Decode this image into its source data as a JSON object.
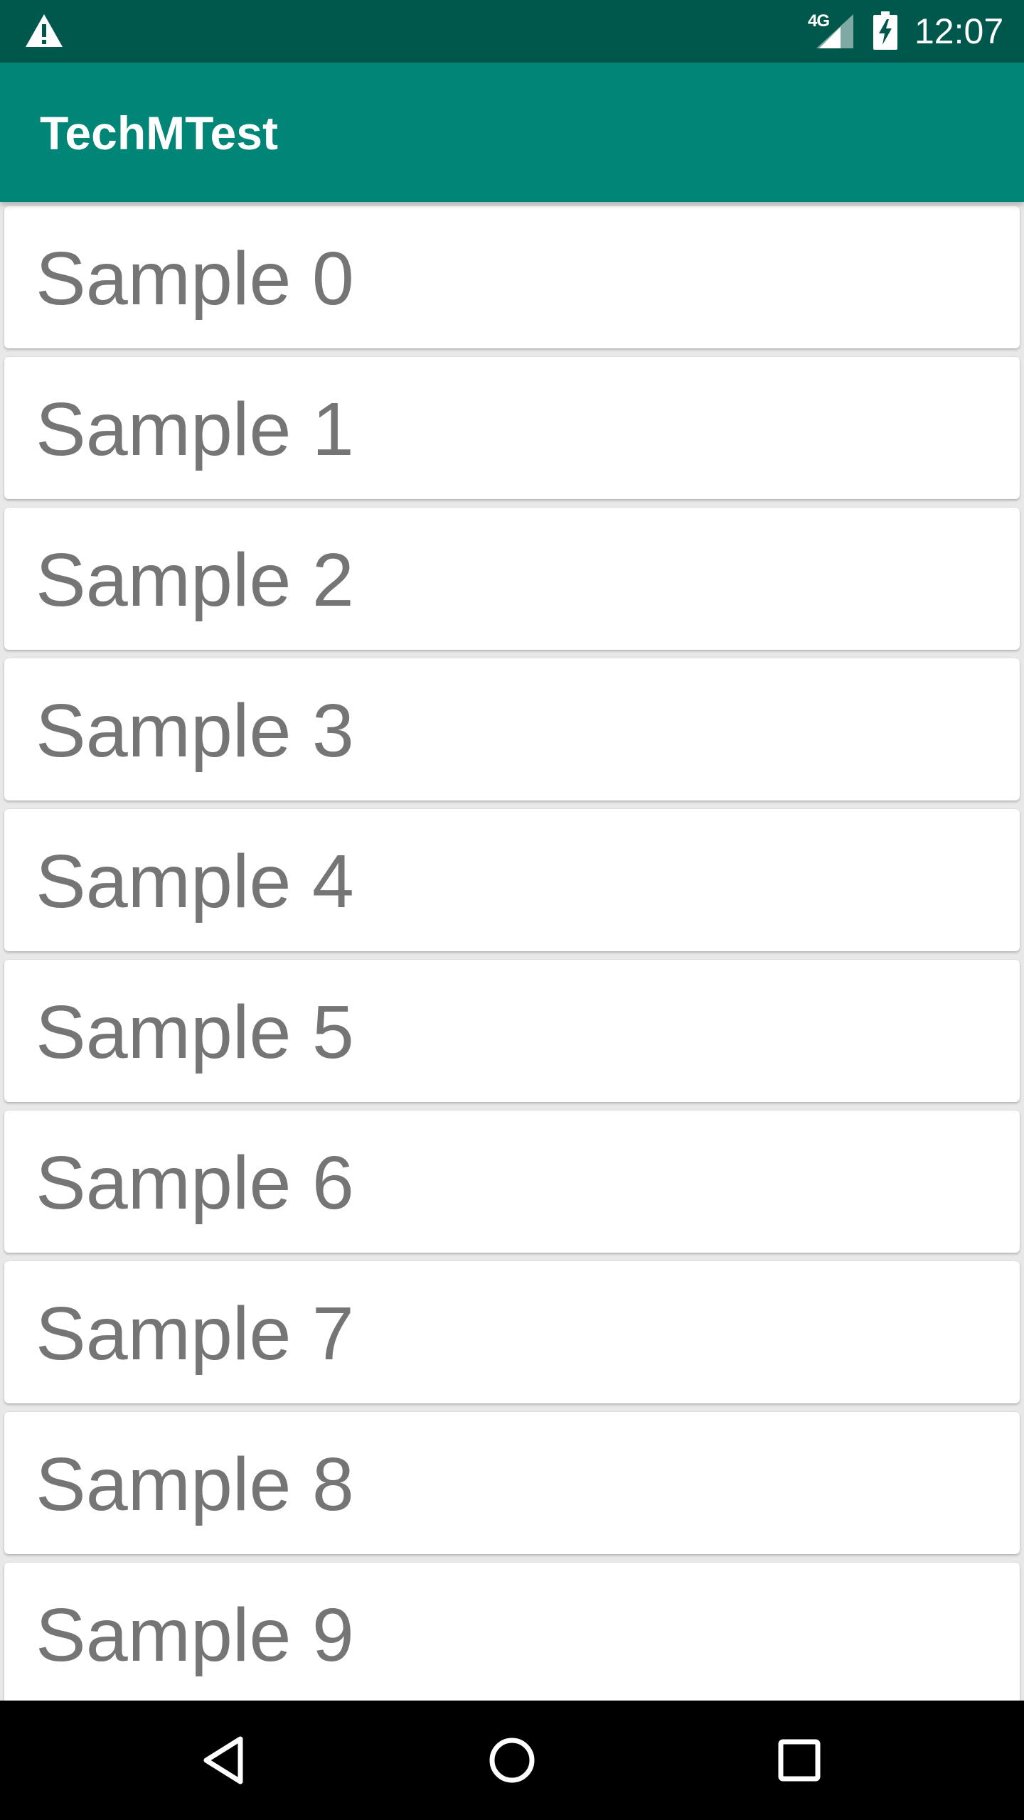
{
  "status_bar": {
    "network": "4G",
    "time": "12:07",
    "icons": [
      "warning-icon",
      "signal-icon",
      "battery-charging-icon"
    ]
  },
  "app_bar": {
    "title": "TechMTest",
    "color": "#008577"
  },
  "list": {
    "items": [
      {
        "label": "Sample 0"
      },
      {
        "label": "Sample 1"
      },
      {
        "label": "Sample 2"
      },
      {
        "label": "Sample 3"
      },
      {
        "label": "Sample 4"
      },
      {
        "label": "Sample 5"
      },
      {
        "label": "Sample 6"
      },
      {
        "label": "Sample 7"
      },
      {
        "label": "Sample 8"
      },
      {
        "label": "Sample 9"
      }
    ]
  },
  "nav_bar": {
    "buttons": [
      "back-icon",
      "home-icon",
      "recents-icon"
    ]
  },
  "colors": {
    "status_bar": "#00574b",
    "app_bar": "#008577",
    "item_text": "#757575",
    "background": "#e8e8e8"
  }
}
